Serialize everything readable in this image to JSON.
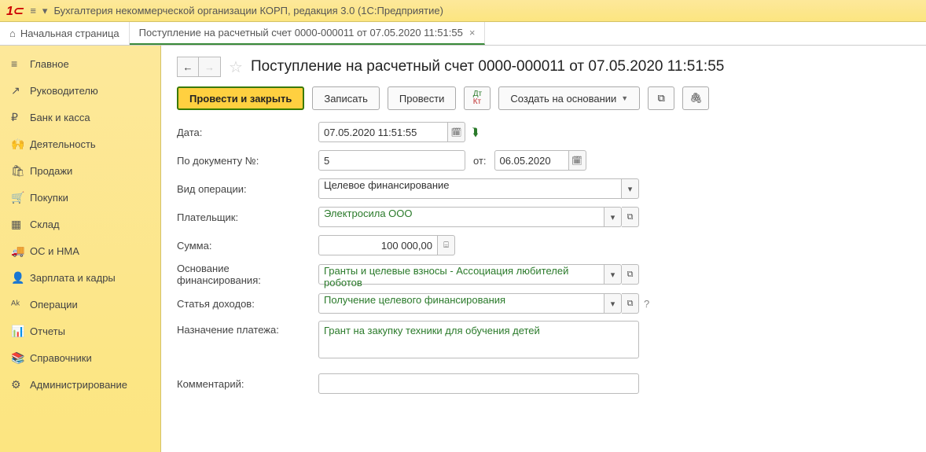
{
  "app": {
    "title": "Бухгалтерия некоммерческой организации КОРП, редакция 3.0  (1С:Предприятие)"
  },
  "tabs": {
    "home": "Начальная страница",
    "doc": "Поступление на расчетный счет 0000-000011 от 07.05.2020 11:51:55"
  },
  "sidebar": [
    {
      "icon": "≡",
      "label": "Главное"
    },
    {
      "icon": "↗",
      "label": "Руководителю"
    },
    {
      "icon": "₽",
      "label": "Банк и касса"
    },
    {
      "icon": "🙌",
      "label": "Деятельность"
    },
    {
      "icon": "🛍",
      "label": "Продажи"
    },
    {
      "icon": "🛒",
      "label": "Покупки"
    },
    {
      "icon": "▦",
      "label": "Склад"
    },
    {
      "icon": "🚚",
      "label": "ОС и НМА"
    },
    {
      "icon": "👤",
      "label": "Зарплата и кадры"
    },
    {
      "icon": "ᴬᵏ",
      "label": "Операции"
    },
    {
      "icon": "📊",
      "label": "Отчеты"
    },
    {
      "icon": "📚",
      "label": "Справочники"
    },
    {
      "icon": "⚙",
      "label": "Администрирование"
    }
  ],
  "doc": {
    "title": "Поступление на расчетный счет 0000-000011 от 07.05.2020 11:51:55"
  },
  "toolbar": {
    "post_close": "Провести и закрыть",
    "save": "Записать",
    "post": "Провести",
    "create_based": "Создать на основании"
  },
  "form": {
    "date_label": "Дата:",
    "date_value": "07.05.2020 11:51:55",
    "docnum_label": "По документу №:",
    "docnum_value": "5",
    "from_label": "от:",
    "from_value": "06.05.2020",
    "optype_label": "Вид операции:",
    "optype_value": "Целевое финансирование",
    "payer_label": "Плательщик:",
    "payer_value": "Электросила ООО",
    "sum_label": "Сумма:",
    "sum_value": "100 000,00",
    "basis_label": "Основание финансирования:",
    "basis_value": "Гранты и целевые взносы - Ассоциация любителей роботов",
    "income_label": "Статья доходов:",
    "income_value": "Получение целевого финансирования",
    "purpose_label": "Назначение платежа:",
    "purpose_value": "Грант на закупку техники для обучения детей",
    "comment_label": "Комментарий:",
    "comment_value": ""
  }
}
